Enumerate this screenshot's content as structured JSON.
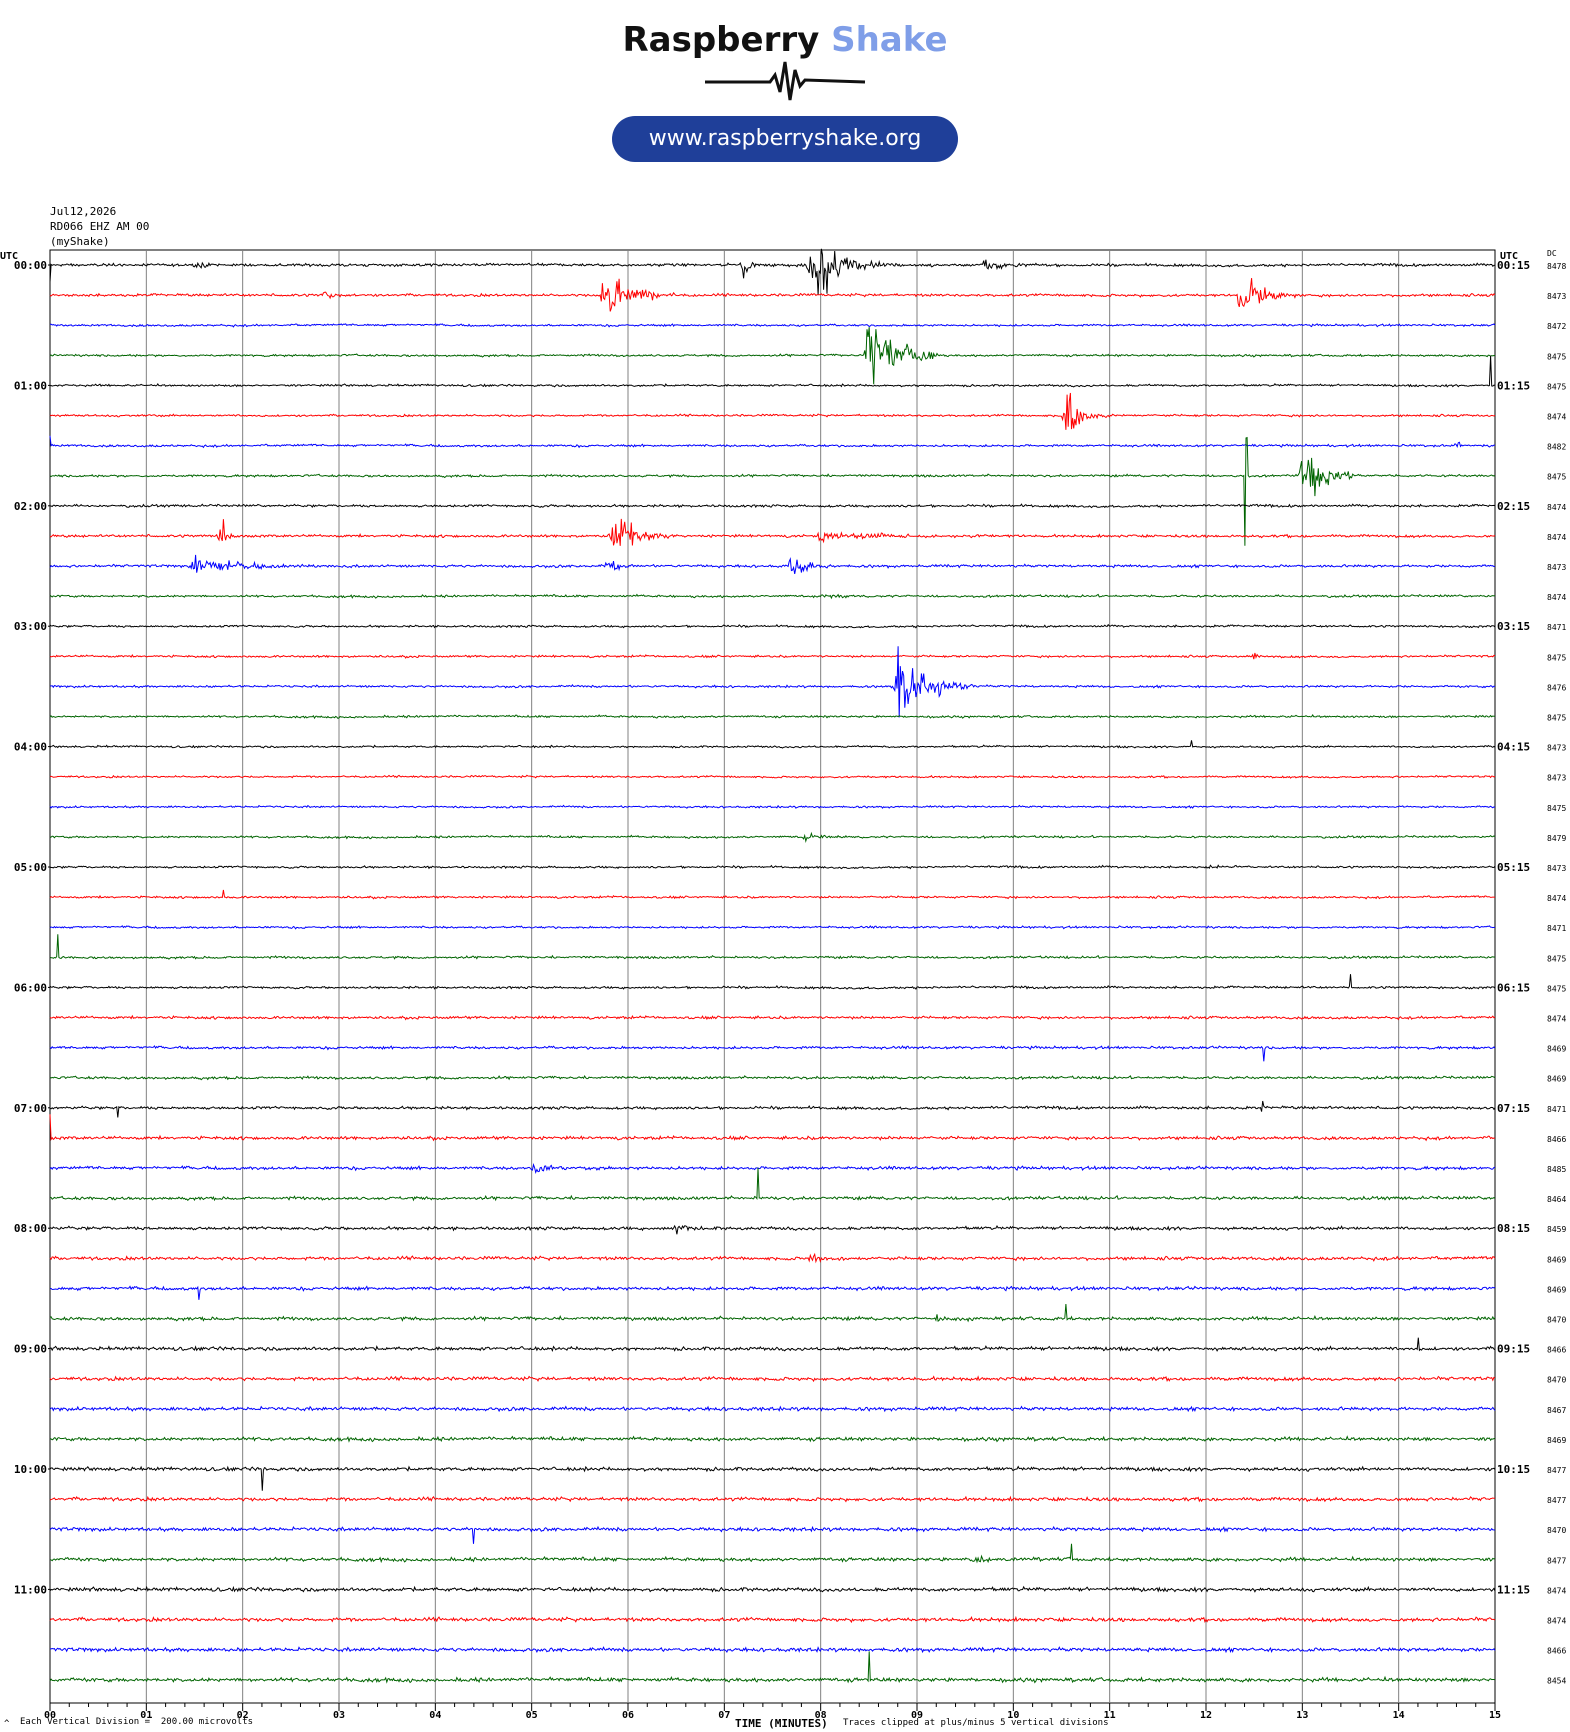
{
  "logo": {
    "brand_part1": "Raspberry",
    "brand_part2": "Shake",
    "url": "www.raspberryshake.org"
  },
  "header": {
    "date": "Jul12,2026",
    "station": "RD066 EHZ AM 00",
    "source": "(myShake)"
  },
  "axis": {
    "left_unit": "UTC",
    "right_unit": "UTC",
    "dc_label": "DC",
    "x_label": "TIME (MINUTES)",
    "x_ticks": [
      "00",
      "01",
      "02",
      "03",
      "04",
      "05",
      "06",
      "07",
      "08",
      "09",
      "10",
      "11",
      "12",
      "13",
      "14",
      "15"
    ]
  },
  "footer": {
    "scale_note": "Each Vertical Division =  200.00 microvolts",
    "clip_note": "Traces clipped at plus/minus 5 vertical divisions",
    "corner_mark": "^"
  },
  "colors": {
    "black": "#000000",
    "red": "#ff0000",
    "blue": "#0000ff",
    "green": "#006400",
    "grid": "#808080"
  },
  "chart_data": {
    "type": "line",
    "title": "",
    "xlabel": "TIME (MINUTES)",
    "ylabel": "",
    "xlim": [
      0,
      15
    ],
    "color_cycle": [
      "black",
      "red",
      "blue",
      "green"
    ],
    "left_hour_labels": [
      "00:00",
      "01:00",
      "02:00",
      "03:00",
      "04:00",
      "05:00",
      "06:00",
      "07:00",
      "08:00",
      "09:00",
      "10:00",
      "11:00"
    ],
    "right_hour_labels": [
      "00:15",
      "01:15",
      "02:15",
      "03:15",
      "04:15",
      "05:15",
      "06:15",
      "07:15",
      "08:15",
      "09:15",
      "10:15",
      "11:15"
    ],
    "dc_offsets": [
      "8478",
      "8473",
      "8472",
      "8475",
      "8475",
      "8474",
      "8482",
      "8475",
      "8474",
      "8474",
      "8473",
      "8474",
      "8471",
      "8475",
      "8476",
      "8475",
      "8473",
      "8473",
      "8475",
      "8479",
      "8473",
      "8474",
      "8471",
      "8475",
      "8475",
      "8474",
      "8469",
      "8469",
      "8471",
      "8466",
      "8485",
      "8464",
      "8459",
      "8469",
      "8469",
      "8470",
      "8466",
      "8470",
      "8467",
      "8469",
      "8477",
      "8477",
      "8470",
      "8477",
      "8474",
      "8474",
      "8466",
      "8454"
    ],
    "noise_levels": [
      1.5,
      1.5,
      1.2,
      1.2,
      1.2,
      1.2,
      1.3,
      1.3,
      1.4,
      1.5,
      1.5,
      1.3,
      1.2,
      1.2,
      1.2,
      1.2,
      1.1,
      1.1,
      1.1,
      1.2,
      1.2,
      1.2,
      1.2,
      1.3,
      1.3,
      1.5,
      1.5,
      1.5,
      1.6,
      1.8,
      1.8,
      1.8,
      1.8,
      1.9,
      1.9,
      1.9,
      2.0,
      2.0,
      2.0,
      2.0,
      2.0,
      2.0,
      2.0,
      2.0,
      2.1,
      2.1,
      2.1,
      2.2
    ],
    "events": [
      {
        "row": 0,
        "minute": 7.2,
        "amplitude": 14,
        "duration": 0.15
      },
      {
        "row": 0,
        "minute": 7.9,
        "amplitude": 34,
        "duration": 0.9
      },
      {
        "row": 0,
        "minute": 9.7,
        "amplitude": 6,
        "duration": 0.6
      },
      {
        "row": 0,
        "minute": 1.55,
        "amplitude": 4,
        "duration": 0.2
      },
      {
        "row": 1,
        "minute": 5.75,
        "amplitude": 26,
        "duration": 0.75
      },
      {
        "row": 1,
        "minute": 12.35,
        "amplitude": 20,
        "duration": 0.6
      },
      {
        "row": 1,
        "minute": 2.85,
        "amplitude": 4,
        "duration": 0.3
      },
      {
        "row": 3,
        "minute": 8.5,
        "amplitude": 40,
        "duration": 0.75
      },
      {
        "row": 5,
        "minute": 10.55,
        "amplitude": 24,
        "duration": 0.45
      },
      {
        "row": 6,
        "minute": 14.6,
        "amplitude": 5,
        "duration": 0.1
      },
      {
        "row": 7,
        "minute": 13.0,
        "amplitude": 30,
        "duration": 0.6
      },
      {
        "row": 9,
        "minute": 5.85,
        "amplitude": 22,
        "duration": 0.6
      },
      {
        "row": 9,
        "minute": 1.75,
        "amplitude": 8,
        "duration": 0.3
      },
      {
        "row": 9,
        "minute": 8.0,
        "amplitude": 5,
        "duration": 1.8
      },
      {
        "row": 10,
        "minute": 1.5,
        "amplitude": 8,
        "duration": 1.5
      },
      {
        "row": 10,
        "minute": 7.7,
        "amplitude": 9,
        "duration": 0.5
      },
      {
        "row": 10,
        "minute": 5.8,
        "amplitude": 9,
        "duration": 0.3
      },
      {
        "row": 11,
        "minute": 8.0,
        "amplitude": 3,
        "duration": 0.4
      },
      {
        "row": 13,
        "minute": 12.5,
        "amplitude": 4,
        "duration": 0.1
      },
      {
        "row": 14,
        "minute": 8.8,
        "amplitude": 32,
        "duration": 0.8
      },
      {
        "row": 19,
        "minute": 7.85,
        "amplitude": 4,
        "duration": 0.4
      },
      {
        "row": 20,
        "minute": 12.0,
        "amplitude": 3,
        "duration": 0.5
      },
      {
        "row": 28,
        "minute": 12.6,
        "amplitude": 8,
        "duration": 0.04
      },
      {
        "row": 30,
        "minute": 5.0,
        "amplitude": 4,
        "duration": 0.8
      },
      {
        "row": 32,
        "minute": 6.5,
        "amplitude": 6,
        "duration": 0.4
      },
      {
        "row": 33,
        "minute": 7.9,
        "amplitude": 6,
        "duration": 0.4
      },
      {
        "row": 35,
        "minute": 9.2,
        "amplitude": 4,
        "duration": 0.4
      },
      {
        "row": 43,
        "minute": 9.6,
        "amplitude": 4,
        "duration": 0.5
      }
    ],
    "spikes": [
      {
        "row": 0,
        "minute": 0.0,
        "amplitude": -18
      },
      {
        "row": 4,
        "minute": 14.95,
        "amplitude": 30
      },
      {
        "row": 6,
        "minute": 0.0,
        "amplitude": 10
      },
      {
        "row": 7,
        "minute": 12.4,
        "amplitude": -70
      },
      {
        "row": 7,
        "minute": 12.42,
        "amplitude": 38
      },
      {
        "row": 9,
        "minute": 1.8,
        "amplitude": 14
      },
      {
        "row": 23,
        "minute": 0.08,
        "amplitude": 24
      },
      {
        "row": 24,
        "minute": 13.5,
        "amplitude": 12
      },
      {
        "row": 28,
        "minute": 0.7,
        "amplitude": -10
      },
      {
        "row": 29,
        "minute": 0.0,
        "amplitude": 24
      },
      {
        "row": 31,
        "minute": 7.35,
        "amplitude": 30
      },
      {
        "row": 34,
        "minute": 1.55,
        "amplitude": -12
      },
      {
        "row": 35,
        "minute": 10.55,
        "amplitude": 14
      },
      {
        "row": 36,
        "minute": 14.2,
        "amplitude": 12
      },
      {
        "row": 40,
        "minute": 2.2,
        "amplitude": -22
      },
      {
        "row": 42,
        "minute": 4.4,
        "amplitude": -14
      },
      {
        "row": 43,
        "minute": 10.6,
        "amplitude": 16
      },
      {
        "row": 47,
        "minute": 8.5,
        "amplitude": 28
      },
      {
        "row": 16,
        "minute": 11.85,
        "amplitude": 6
      },
      {
        "row": 21,
        "minute": 1.8,
        "amplitude": 8
      },
      {
        "row": 26,
        "minute": 12.6,
        "amplitude": -14
      }
    ]
  }
}
